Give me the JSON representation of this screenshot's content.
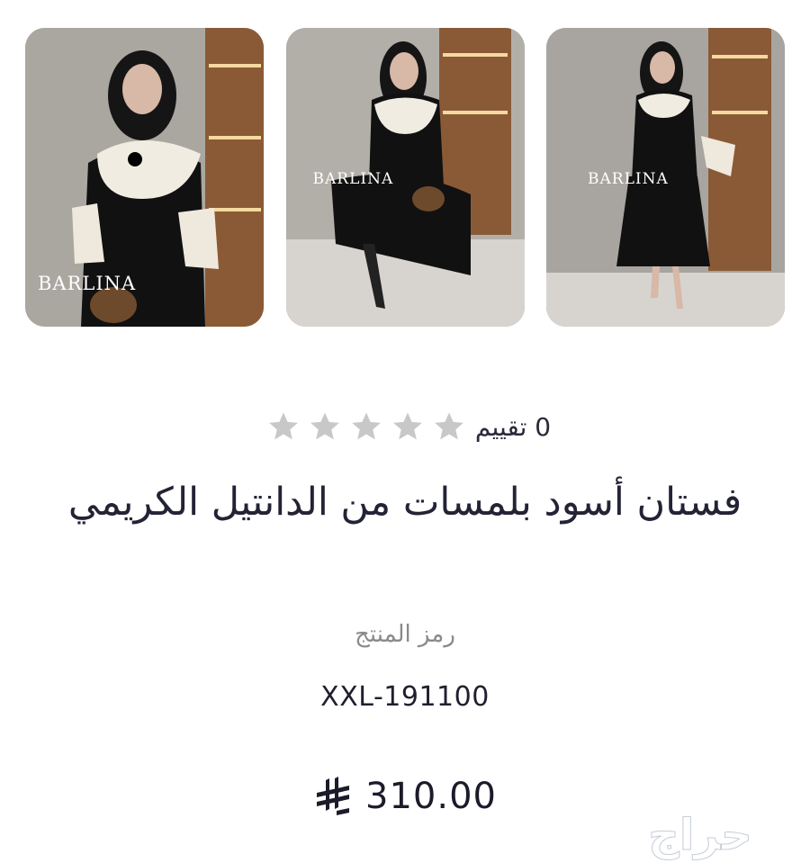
{
  "gallery": {
    "images": [
      {
        "watermark": "BARLINA"
      },
      {
        "watermark": "BARLINA"
      },
      {
        "watermark": "BARLINA"
      }
    ]
  },
  "rating": {
    "stars": 0,
    "max_stars": 5,
    "count_label": "0 تقييم",
    "star_color": "#c8c8c8"
  },
  "product": {
    "title": "فستان أسود بلمسات من الدانتيل الكريمي",
    "sku_label": "رمز المنتج",
    "sku": "XXL-191100",
    "price": "310.00",
    "currency_icon": "saudi-riyal-icon"
  },
  "site": {
    "watermark": "حراج"
  }
}
